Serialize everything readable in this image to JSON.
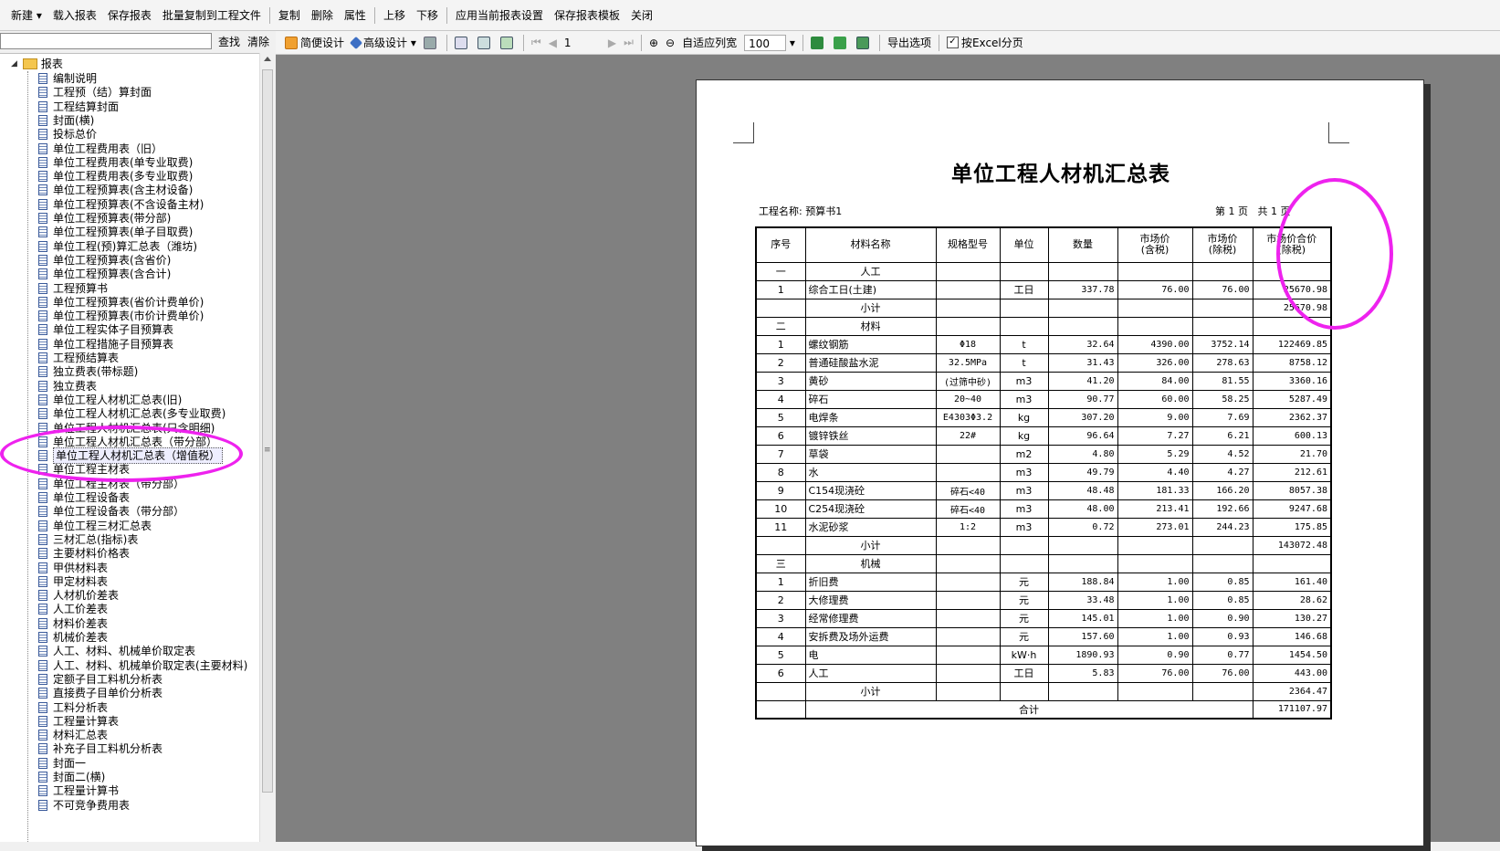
{
  "menu": {
    "items": [
      "新建 ▾",
      "载入报表",
      "保存报表",
      "批量复制到工程文件",
      "复制",
      "删除",
      "属性",
      "上移",
      "下移",
      "应用当前报表设置",
      "保存报表模板",
      "关闭"
    ]
  },
  "search": {
    "find": "查找",
    "clear": "清除"
  },
  "tree": {
    "root": "报表",
    "items": [
      "编制说明",
      "工程预（结）算封面",
      "工程结算封面",
      "封面(横)",
      "投标总价",
      "单位工程费用表（旧）",
      "单位工程费用表(单专业取费)",
      "单位工程费用表(多专业取费)",
      "单位工程预算表(含主材设备)",
      "单位工程预算表(不含设备主材)",
      "单位工程预算表(带分部)",
      "单位工程预算表(单子目取费)",
      "单位工程(预)算汇总表（潍坊)",
      "单位工程预算表(含省价)",
      "单位工程预算表(含合计)",
      "工程预算书",
      "单位工程预算表(省价计费单价)",
      "单位工程预算表(市价计费单价)",
      "单位工程实体子目预算表",
      "单位工程措施子目预算表",
      "工程预结算表",
      "独立费表(带标题)",
      "独立费表",
      "单位工程人材机汇总表(旧)",
      "单位工程人材机汇总表(多专业取费)",
      "单位工程人材机汇总表(只含明细)",
      "单位工程人材机汇总表（带分部）",
      "单位工程人材机汇总表（增值税）",
      "单位工程主材表",
      "单位工程主材表（带分部）",
      "单位工程设备表",
      "单位工程设备表（带分部）",
      "单位工程三材汇总表",
      "三材汇总(指标)表",
      "主要材料价格表",
      "甲供材料表",
      "甲定材料表",
      "人材机价差表",
      "人工价差表",
      "材料价差表",
      "机械价差表",
      "人工、材料、机械单价取定表",
      "人工、材料、机械单价取定表(主要材料)",
      "定额子目工料机分析表",
      "直接费子目单价分析表",
      "工料分析表",
      "工程量计算表",
      "材料汇总表",
      "补充子目工料机分析表",
      "封面一",
      "封面二(横)",
      "工程量计算书",
      "不可竞争费用表"
    ],
    "selected_index": 27
  },
  "toolbar": {
    "simple_design": "简便设计",
    "advanced_design": "高级设计",
    "page_num": "1",
    "fit_width": "自适应列宽",
    "zoom": "100",
    "export_options": "导出选项",
    "excel_paging": "按Excel分页",
    "excel_paging_checked": true
  },
  "report": {
    "title": "单位工程人材机汇总表",
    "project_label": "工程名称: 预算书1",
    "page_info": "第 1 页   共 1 页",
    "headers": [
      "序号",
      "材料名称",
      "规格型号",
      "单位",
      "数量",
      "市场价\n(含税)",
      "市场价\n(除税)",
      "市场价合价\n(除税)"
    ],
    "rows": [
      [
        "一",
        "人工",
        "",
        "",
        "",
        "",
        "",
        ""
      ],
      [
        "1",
        "综合工日(土建)",
        "",
        "工日",
        "337.78",
        "76.00",
        "76.00",
        "25670.98"
      ],
      [
        "",
        "小计",
        "",
        "",
        "",
        "",
        "",
        "25670.98"
      ],
      [
        "二",
        "材料",
        "",
        "",
        "",
        "",
        "",
        ""
      ],
      [
        "1",
        "螺纹钢筋",
        "Φ18",
        "t",
        "32.64",
        "4390.00",
        "3752.14",
        "122469.85"
      ],
      [
        "2",
        "普通硅酸盐水泥",
        "32.5MPa",
        "t",
        "31.43",
        "326.00",
        "278.63",
        "8758.12"
      ],
      [
        "3",
        "黄砂",
        "(过筛中砂)",
        "m3",
        "41.20",
        "84.00",
        "81.55",
        "3360.16"
      ],
      [
        "4",
        "碎石",
        "20~40",
        "m3",
        "90.77",
        "60.00",
        "58.25",
        "5287.49"
      ],
      [
        "5",
        "电焊条",
        "E4303Φ3.2",
        "kg",
        "307.20",
        "9.00",
        "7.69",
        "2362.37"
      ],
      [
        "6",
        "镀锌铁丝",
        "22#",
        "kg",
        "96.64",
        "7.27",
        "6.21",
        "600.13"
      ],
      [
        "7",
        "草袋",
        "",
        "m2",
        "4.80",
        "5.29",
        "4.52",
        "21.70"
      ],
      [
        "8",
        "水",
        "",
        "m3",
        "49.79",
        "4.40",
        "4.27",
        "212.61"
      ],
      [
        "9",
        "C154现浇砼",
        "碎石<40",
        "m3",
        "48.48",
        "181.33",
        "166.20",
        "8057.38"
      ],
      [
        "10",
        "C254现浇砼",
        "碎石<40",
        "m3",
        "48.00",
        "213.41",
        "192.66",
        "9247.68"
      ],
      [
        "11",
        "水泥砂浆",
        "1:2",
        "m3",
        "0.72",
        "273.01",
        "244.23",
        "175.85"
      ],
      [
        "",
        "小计",
        "",
        "",
        "",
        "",
        "",
        "143072.48"
      ],
      [
        "三",
        "机械",
        "",
        "",
        "",
        "",
        "",
        ""
      ],
      [
        "1",
        "折旧费",
        "",
        "元",
        "188.84",
        "1.00",
        "0.85",
        "161.40"
      ],
      [
        "2",
        "大修理费",
        "",
        "元",
        "33.48",
        "1.00",
        "0.85",
        "28.62"
      ],
      [
        "3",
        "经常修理费",
        "",
        "元",
        "145.01",
        "1.00",
        "0.90",
        "130.27"
      ],
      [
        "4",
        "安拆费及场外运费",
        "",
        "元",
        "157.60",
        "1.00",
        "0.93",
        "146.68"
      ],
      [
        "5",
        "电",
        "",
        "kW·h",
        "1890.93",
        "0.90",
        "0.77",
        "1454.50"
      ],
      [
        "6",
        "人工",
        "",
        "工日",
        "5.83",
        "76.00",
        "76.00",
        "443.00"
      ],
      [
        "",
        "小计",
        "",
        "",
        "",
        "",
        "",
        "2364.47"
      ]
    ],
    "total_label": "合计",
    "total_value": "171107.97"
  },
  "colors": {
    "annotation": "#ee22ee",
    "viewer_bg": "#808080"
  }
}
